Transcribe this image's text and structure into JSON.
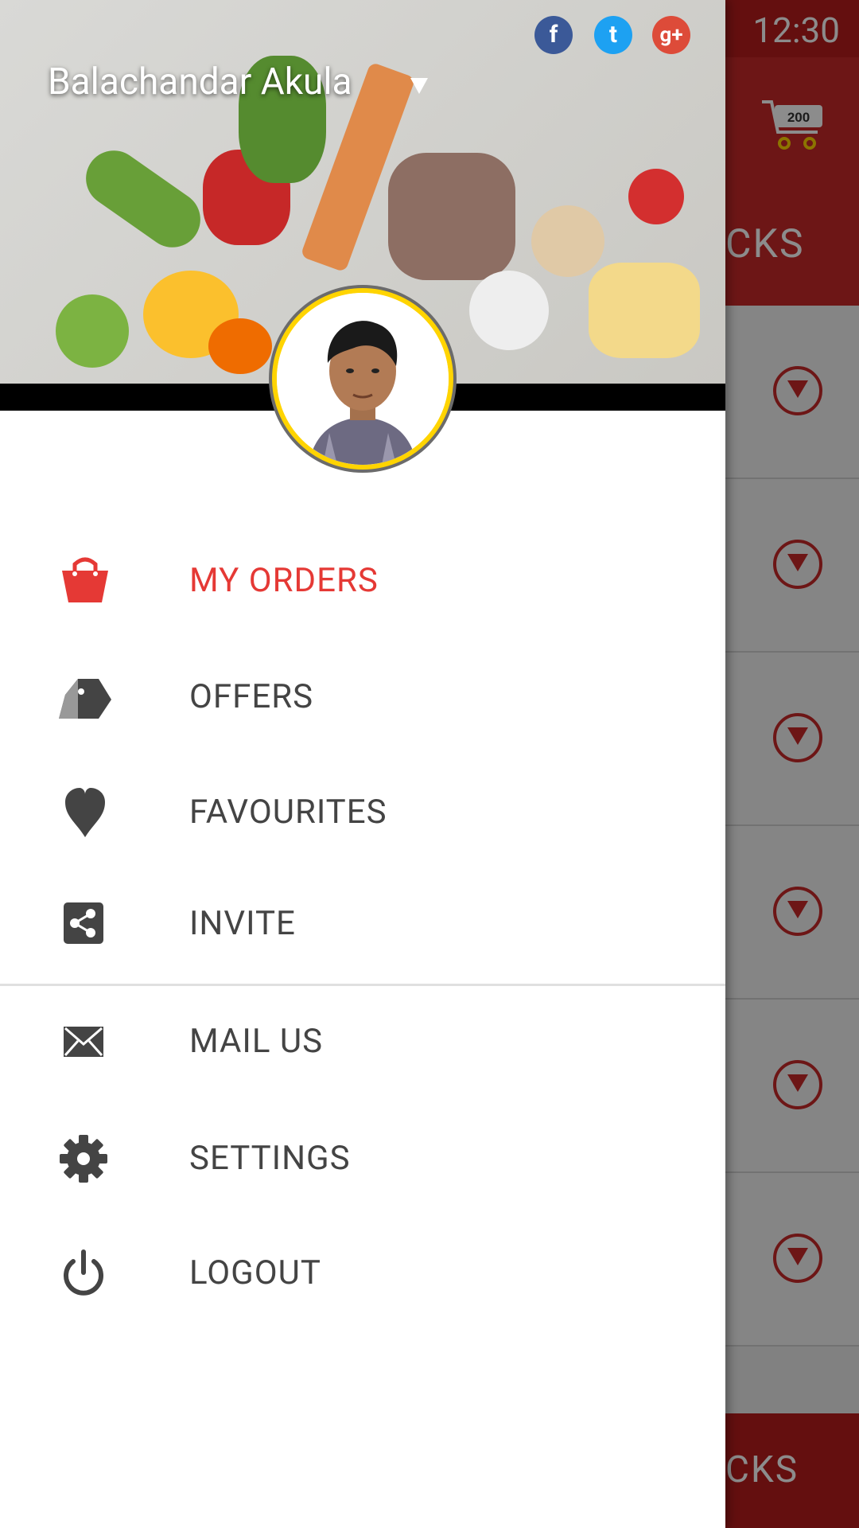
{
  "status_bar": {
    "time": "12:30"
  },
  "background_app": {
    "cart_count": "200",
    "tab_label": "CKS",
    "bottom_label": "CKS"
  },
  "drawer": {
    "user_name": "Balachandar Akula",
    "social": [
      "f",
      "t",
      "g+"
    ],
    "menu": [
      {
        "label": "MY ORDERS",
        "icon": "shopping-bag-icon",
        "active": true
      },
      {
        "label": "OFFERS",
        "icon": "tag-icon"
      },
      {
        "label": "FAVOURITES",
        "icon": "heart-icon"
      },
      {
        "label": "INVITE",
        "icon": "share-icon"
      },
      {
        "label": "MAIL US",
        "icon": "mail-icon"
      },
      {
        "label": "SETTINGS",
        "icon": "gear-icon"
      },
      {
        "label": "LOGOUT",
        "icon": "power-icon"
      }
    ]
  },
  "colors": {
    "accent": "#e53935",
    "primary_dark": "#b71c1c",
    "text": "#444444",
    "avatar_ring": "#ffd400"
  }
}
